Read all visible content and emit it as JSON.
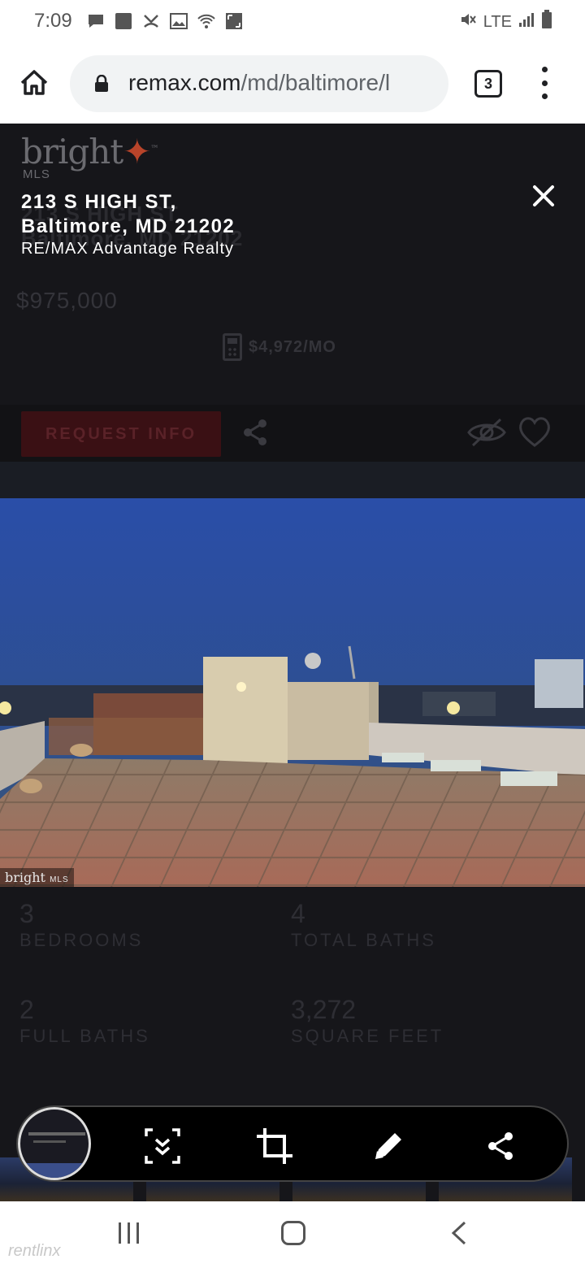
{
  "status_bar": {
    "time": "7:09",
    "network": "LTE"
  },
  "browser": {
    "url_host": "remax.com",
    "url_path": "/md/baltimore/l",
    "tab_count": "3"
  },
  "listing": {
    "logo_text": "bright",
    "logo_sub": "MLS",
    "address_line1": "213 S HIGH ST,",
    "address_line2": "Baltimore, MD 21202",
    "agent": "RE/MAX Advantage Realty",
    "price": "$975,000",
    "monthly": "$4,972/MO",
    "request_info_label": "REQUEST INFO",
    "photo_badge": "bright",
    "photo_badge_sub": "MLS",
    "stats": [
      {
        "value": "3",
        "label": "BEDROOMS"
      },
      {
        "value": "4",
        "label": "TOTAL BATHS"
      },
      {
        "value": "2",
        "label": "FULL BATHS"
      },
      {
        "value": "3,272",
        "label": "SQUARE FEET"
      }
    ]
  },
  "screenshot_toolbar": {
    "icons": [
      "scroll-capture-icon",
      "crop-icon",
      "edit-pencil-icon",
      "share-icon"
    ]
  },
  "watermark": "rentlinx",
  "colors": {
    "accent_red": "#3a1014",
    "page_bg": "#16161a"
  }
}
